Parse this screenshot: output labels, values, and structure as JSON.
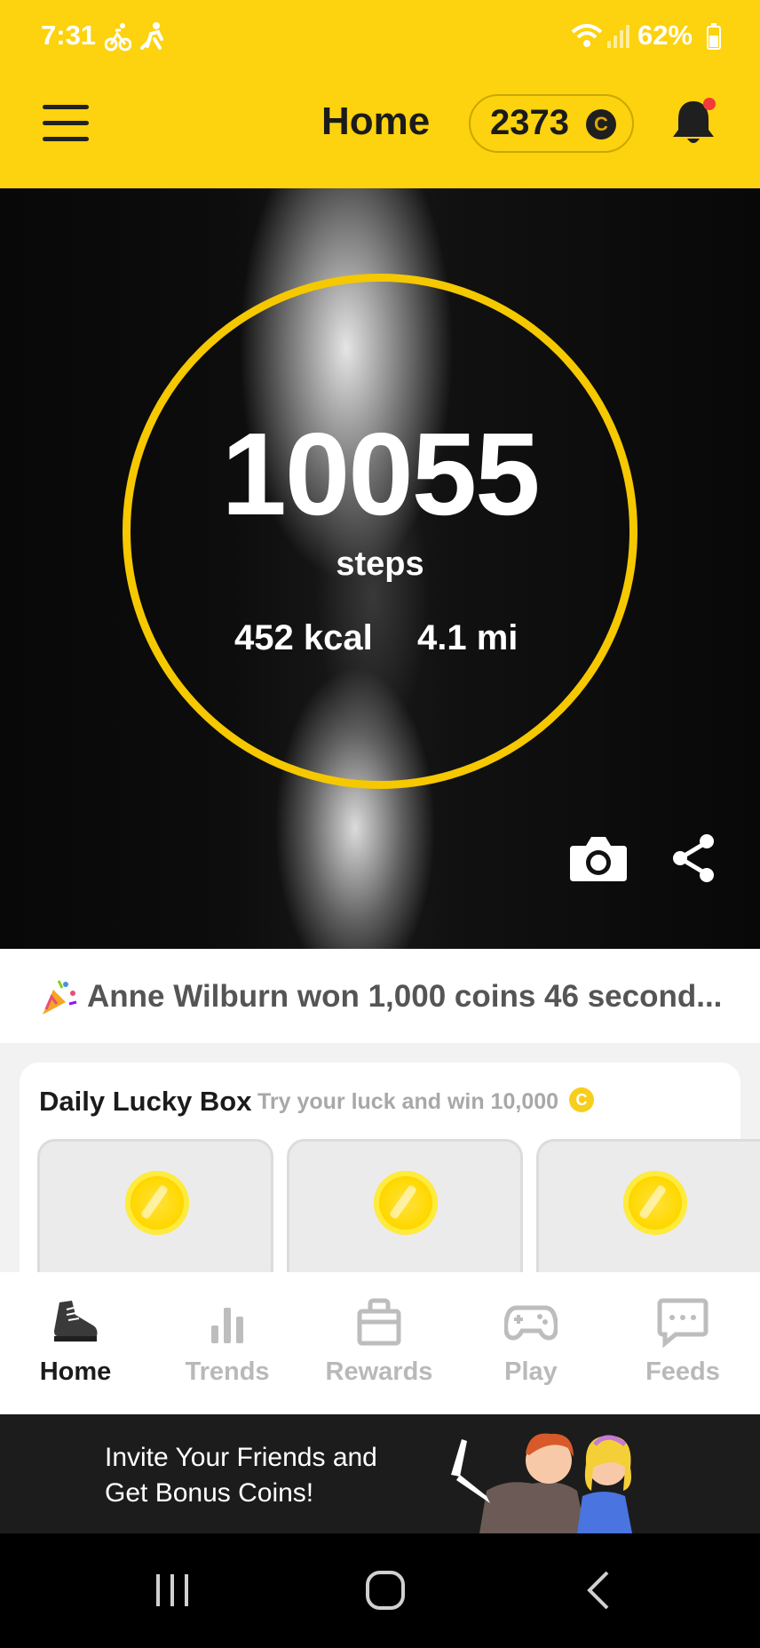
{
  "status_bar": {
    "time": "7:31",
    "battery_percent": "62%",
    "icons": [
      "bike-icon",
      "run-icon",
      "wifi-icon",
      "signal-icon",
      "battery-icon"
    ]
  },
  "header": {
    "title": "Home",
    "coin_count": "2373",
    "coin_symbol": "C"
  },
  "activity": {
    "steps": "10055",
    "steps_label": "steps",
    "calories": "452 kcal",
    "distance": "4.1 mi"
  },
  "ticker": {
    "text": "Anne Wilburn won 1,000 coins 46 second..."
  },
  "lucky_box": {
    "title": "Daily Lucky Box",
    "subtitle": "Try your luck and win 10,000",
    "coin_symbol": "C"
  },
  "nav": {
    "items": [
      {
        "label": "Home",
        "icon": "shoe-icon",
        "active": true
      },
      {
        "label": "Trends",
        "icon": "bar-chart-icon",
        "active": false
      },
      {
        "label": "Rewards",
        "icon": "shopping-bag-icon",
        "active": false
      },
      {
        "label": "Play",
        "icon": "gamepad-icon",
        "active": false
      },
      {
        "label": "Feeds",
        "icon": "chat-icon",
        "active": false
      }
    ]
  },
  "banner": {
    "line1": "Invite Your Friends and",
    "line2": "Get Bonus Coins!"
  },
  "colors": {
    "brand_yellow": "#FDD20E",
    "ring_yellow": "#F5C800",
    "notification_red": "#F23B3B"
  }
}
